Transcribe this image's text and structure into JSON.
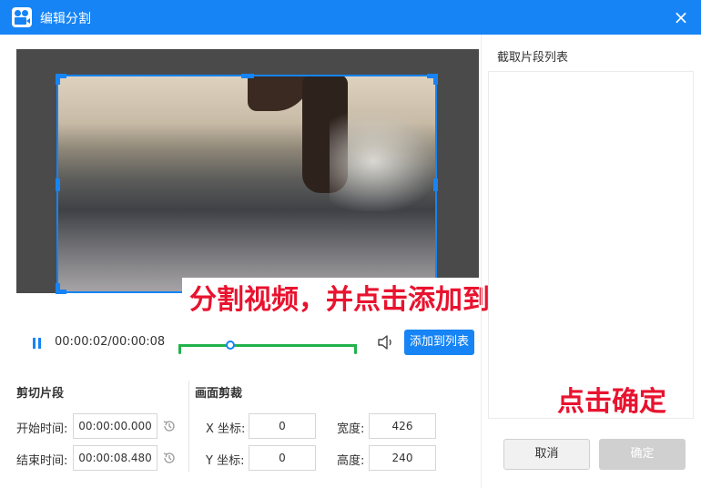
{
  "window": {
    "title": "编辑分割",
    "close_icon": "×"
  },
  "preview": {
    "time_display": "00:00:02/00:00:08",
    "add_button_label": "添加到列表",
    "playhead_fraction": 0.3
  },
  "overlay": {
    "instruction_1": "分割视频，并点击添加到列表",
    "instruction_2": "点击确定"
  },
  "trim": {
    "title": "剪切片段",
    "start_label": "开始时间:",
    "start_value": "00:00:00.000",
    "end_label": "结束时间:",
    "end_value": "00:00:08.480"
  },
  "crop": {
    "title": "画面剪裁",
    "x_label": "X 坐标:",
    "x_value": "0",
    "y_label": "Y 坐标:",
    "y_value": "0",
    "width_label": "宽度:",
    "width_value": "426",
    "height_label": "高度:",
    "height_value": "240"
  },
  "side": {
    "title": "截取片段列表",
    "cancel_label": "取消",
    "ok_label": "确定"
  },
  "colors": {
    "accent": "#1684f5",
    "track": "#21b24b",
    "overlay_text": "#e8132f"
  }
}
